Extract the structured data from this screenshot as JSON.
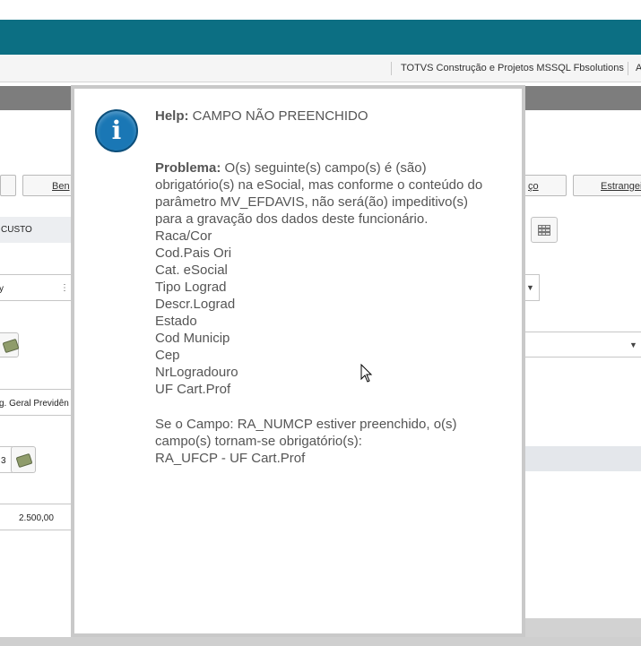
{
  "status_bar": {
    "company": "TOTVS Construção e Projetos MSSQL Fbsolutions",
    "extra": "A"
  },
  "background_form": {
    "tabs": {
      "left_partial": "Ben",
      "mid_partial": "ço",
      "right_partial": "Estrangei"
    },
    "header_label": "CUSTO",
    "field_dropdown_partial": "y",
    "field_regime_partial": "g. Geral Previdên",
    "field_code_partial": "3",
    "field_amount": "2.500,00"
  },
  "dialog": {
    "icon": "info-icon",
    "help_label": "Help:",
    "help_title": "CAMPO NÃO PREENCHIDO",
    "problem_label": "Problema:",
    "problem_lines": [
      "O(s) seguinte(s) campo(s) é (são)",
      "obrigatório(s) na eSocial, mas conforme o conteúdo do",
      "parâmetro MV_EFDAVIS, não será(ão) impeditivo(s)",
      "para a gravação dos dados deste funcionário."
    ],
    "fields": [
      "Raca/Cor",
      "Cod.Pais Ori",
      "Cat. eSocial",
      "Tipo Lograd",
      "Descr.Lograd",
      "Estado",
      "Cod Municip",
      "Cep",
      "NrLogradouro",
      "UF Cart.Prof"
    ],
    "conditional_lines": [
      "Se o Campo: RA_NUMCP estiver preenchido, o(s)",
      "campo(s) tornam-se obrigatório(s):",
      "RA_UFCP - UF Cart.Prof"
    ]
  }
}
